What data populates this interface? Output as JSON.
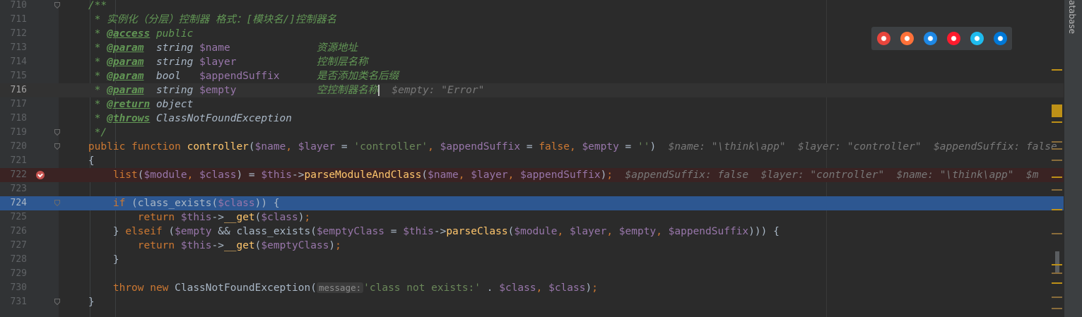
{
  "editor": {
    "lines": [
      {
        "num": "710",
        "tokens": [
          {
            "c": "c",
            "t": "    /**"
          }
        ]
      },
      {
        "num": "711",
        "tokens": [
          {
            "c": "c",
            "t": "     * 实例化（分层）控制器 格式：[模块名/]控制器名"
          }
        ]
      },
      {
        "num": "712",
        "tokens": [
          {
            "c": "c",
            "t": "     * "
          },
          {
            "c": "tag",
            "t": "@access"
          },
          {
            "c": "c",
            "t": " public"
          }
        ]
      },
      {
        "num": "713",
        "tokens": [
          {
            "c": "c",
            "t": "     * "
          },
          {
            "c": "tag",
            "t": "@param"
          },
          {
            "c": "ci",
            "t": "  string "
          },
          {
            "c": "v",
            "t": "$name"
          },
          {
            "c": "c",
            "t": "              资源地址"
          }
        ]
      },
      {
        "num": "714",
        "tokens": [
          {
            "c": "c",
            "t": "     * "
          },
          {
            "c": "tag",
            "t": "@param"
          },
          {
            "c": "ci",
            "t": "  string "
          },
          {
            "c": "v",
            "t": "$layer"
          },
          {
            "c": "c",
            "t": "             控制层名称"
          }
        ]
      },
      {
        "num": "715",
        "tokens": [
          {
            "c": "c",
            "t": "     * "
          },
          {
            "c": "tag",
            "t": "@param"
          },
          {
            "c": "ci",
            "t": "  bool   "
          },
          {
            "c": "v",
            "t": "$appendSuffix"
          },
          {
            "c": "c",
            "t": "      是否添加类名后缀"
          }
        ]
      },
      {
        "num": "716",
        "cls": "cur",
        "tokens": [
          {
            "c": "c",
            "t": "     * "
          },
          {
            "c": "tag",
            "t": "@param"
          },
          {
            "c": "ci",
            "t": "  string "
          },
          {
            "c": "v",
            "t": "$empty"
          },
          {
            "c": "c",
            "t": "             空控制器名称"
          },
          {
            "c": "caret",
            "t": ""
          },
          {
            "c": "hint",
            "t": "  $empty: \"Error\""
          }
        ]
      },
      {
        "num": "717",
        "tokens": [
          {
            "c": "c",
            "t": "     * "
          },
          {
            "c": "tag",
            "t": "@return"
          },
          {
            "c": "ci",
            "t": " object"
          }
        ]
      },
      {
        "num": "718",
        "tokens": [
          {
            "c": "c",
            "t": "     * "
          },
          {
            "c": "tag",
            "t": "@throws"
          },
          {
            "c": "ci",
            "t": " ClassNotFoundException"
          }
        ]
      },
      {
        "num": "719",
        "tokens": [
          {
            "c": "c",
            "t": "     */"
          }
        ]
      },
      {
        "num": "720",
        "tokens": [
          {
            "c": "k",
            "t": "    public function "
          },
          {
            "c": "fn",
            "t": "controller"
          },
          {
            "c": "t",
            "t": "("
          },
          {
            "c": "v",
            "t": "$name"
          },
          {
            "c": "k",
            "t": ", "
          },
          {
            "c": "v",
            "t": "$layer"
          },
          {
            "c": "t",
            "t": " = "
          },
          {
            "c": "s",
            "t": "'controller'"
          },
          {
            "c": "k",
            "t": ", "
          },
          {
            "c": "v",
            "t": "$appendSuffix"
          },
          {
            "c": "t",
            "t": " = "
          },
          {
            "c": "k",
            "t": "false"
          },
          {
            "c": "k",
            "t": ", "
          },
          {
            "c": "v",
            "t": "$empty"
          },
          {
            "c": "t",
            "t": " = "
          },
          {
            "c": "s",
            "t": "''"
          },
          {
            "c": "t",
            "t": ")"
          },
          {
            "c": "hint",
            "t": "  $name: \"\\think\\app\"  $layer: \"controller\"  $appendSuffix: false"
          }
        ]
      },
      {
        "num": "721",
        "tokens": [
          {
            "c": "t",
            "t": "    {"
          }
        ]
      },
      {
        "num": "722",
        "cls": "bp",
        "tokens": [
          {
            "c": "fn2",
            "t": "        list"
          },
          {
            "c": "t",
            "t": "("
          },
          {
            "c": "v",
            "t": "$module"
          },
          {
            "c": "k",
            "t": ", "
          },
          {
            "c": "v",
            "t": "$class"
          },
          {
            "c": "t",
            "t": ") = "
          },
          {
            "c": "v",
            "t": "$this"
          },
          {
            "c": "t",
            "t": "->"
          },
          {
            "c": "fn",
            "t": "parseModuleAndClass"
          },
          {
            "c": "t",
            "t": "("
          },
          {
            "c": "v",
            "t": "$name"
          },
          {
            "c": "k",
            "t": ", "
          },
          {
            "c": "v",
            "t": "$layer"
          },
          {
            "c": "k",
            "t": ", "
          },
          {
            "c": "v",
            "t": "$appendSuffix"
          },
          {
            "c": "t",
            "t": ")"
          },
          {
            "c": "k",
            "t": ";"
          },
          {
            "c": "hint",
            "t": "  $appendSuffix: false  $layer: \"controller\"  $name: \"\\think\\app\"  $m"
          }
        ]
      },
      {
        "num": "723",
        "tokens": []
      },
      {
        "num": "724",
        "cls": "exec",
        "tokens": [
          {
            "c": "k",
            "t": "        if "
          },
          {
            "c": "t",
            "t": "(class_exists("
          },
          {
            "c": "v",
            "t": "$class"
          },
          {
            "c": "t",
            "t": ")) {"
          }
        ]
      },
      {
        "num": "725",
        "tokens": [
          {
            "c": "k",
            "t": "            return "
          },
          {
            "c": "v",
            "t": "$this"
          },
          {
            "c": "t",
            "t": "->"
          },
          {
            "c": "fn",
            "t": "__get"
          },
          {
            "c": "t",
            "t": "("
          },
          {
            "c": "v",
            "t": "$class"
          },
          {
            "c": "t",
            "t": ")"
          },
          {
            "c": "k",
            "t": ";"
          }
        ]
      },
      {
        "num": "726",
        "tokens": [
          {
            "c": "t",
            "t": "        } "
          },
          {
            "c": "k",
            "t": "elseif "
          },
          {
            "c": "t",
            "t": "("
          },
          {
            "c": "v",
            "t": "$empty"
          },
          {
            "c": "t",
            "t": " && class_exists("
          },
          {
            "c": "v",
            "t": "$emptyClass"
          },
          {
            "c": "t",
            "t": " = "
          },
          {
            "c": "v",
            "t": "$this"
          },
          {
            "c": "t",
            "t": "->"
          },
          {
            "c": "fn",
            "t": "parseClass"
          },
          {
            "c": "t",
            "t": "("
          },
          {
            "c": "v",
            "t": "$module"
          },
          {
            "c": "k",
            "t": ", "
          },
          {
            "c": "v",
            "t": "$layer"
          },
          {
            "c": "k",
            "t": ", "
          },
          {
            "c": "v",
            "t": "$empty"
          },
          {
            "c": "k",
            "t": ", "
          },
          {
            "c": "v",
            "t": "$appendSuffix"
          },
          {
            "c": "t",
            "t": "))) {"
          }
        ]
      },
      {
        "num": "727",
        "tokens": [
          {
            "c": "k",
            "t": "            return "
          },
          {
            "c": "v",
            "t": "$this"
          },
          {
            "c": "t",
            "t": "->"
          },
          {
            "c": "fn",
            "t": "__get"
          },
          {
            "c": "t",
            "t": "("
          },
          {
            "c": "v",
            "t": "$emptyClass"
          },
          {
            "c": "t",
            "t": ")"
          },
          {
            "c": "k",
            "t": ";"
          }
        ]
      },
      {
        "num": "728",
        "tokens": [
          {
            "c": "t",
            "t": "        }"
          }
        ]
      },
      {
        "num": "729",
        "tokens": []
      },
      {
        "num": "730",
        "tokens": [
          {
            "c": "k",
            "t": "        throw new "
          },
          {
            "c": "t",
            "t": "ClassNotFoundException("
          },
          {
            "c": "pname",
            "t": "message:"
          },
          {
            "c": "s",
            "t": "'class not exists:'"
          },
          {
            "c": "t",
            "t": " . "
          },
          {
            "c": "v",
            "t": "$class"
          },
          {
            "c": "k",
            "t": ", "
          },
          {
            "c": "v",
            "t": "$class"
          },
          {
            "c": "t",
            "t": ")"
          },
          {
            "c": "k",
            "t": ";"
          }
        ]
      },
      {
        "num": "731",
        "tokens": [
          {
            "c": "t",
            "t": "    }"
          }
        ]
      }
    ]
  },
  "tool_window": {
    "label": "atabase"
  },
  "browsers": [
    {
      "name": "chrome-icon",
      "color": "#e8453c"
    },
    {
      "name": "firefox-icon",
      "color": "#ff7139"
    },
    {
      "name": "safari-icon",
      "color": "#1e88e5"
    },
    {
      "name": "opera-icon",
      "color": "#ff1b2d"
    },
    {
      "name": "ie-icon",
      "color": "#1ebbee"
    },
    {
      "name": "edge-icon",
      "color": "#0078d7"
    }
  ]
}
